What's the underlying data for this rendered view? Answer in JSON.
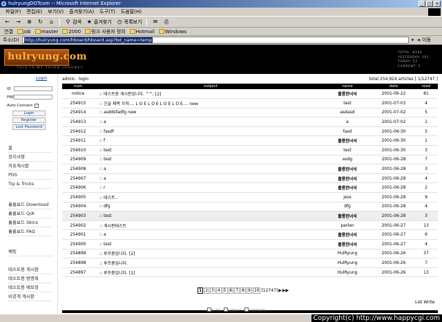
{
  "window": {
    "title": "hulryungDOTcom -- Microsoft Internet Explorer",
    "controls": [
      "_",
      "□",
      "×"
    ]
  },
  "menu": [
    "파일(F)",
    "편집(E)",
    "보기(V)",
    "즐겨찾기(A)",
    "도구(T)",
    "도움말(H)"
  ],
  "toolbar": {
    "back": "←",
    "forward": "→",
    "stop": "⊗",
    "refresh": "↻",
    "home": "⌂",
    "search": "검색",
    "favorites": "즐겨찾기",
    "history": "목록보기",
    "mail": "✉",
    "print": "⎙"
  },
  "links": {
    "label": "연결",
    "items": [
      "job",
      "master",
      "2000",
      "링크 사용자 정의",
      "Hotmail",
      "Windows"
    ]
  },
  "address": {
    "label": "주소(D)",
    "url": "http://hulryung.com/hboard/hboard.asp?bd_name=temp",
    "go": "이동"
  },
  "banner": {
    "logo": "hulryung.com",
    "tagline": "THIS IS MY THIRD JOURNEY",
    "stats": [
      "TOTAL: 8334",
      "YESTERDAY: 161",
      "TODAY: 53",
      "CURRENT: 5"
    ]
  },
  "sidebar": {
    "login_title": "Login",
    "id_label": "ID",
    "pwd_label": "PWD",
    "auto_connect": "Auto Connect",
    "login_button": "Login",
    "register_button": "Register",
    "lost_password": "Lost Password",
    "nav1": [
      "홈",
      "공지사항",
      "자유게시판",
      "PDS",
      "Tip & Tricks"
    ],
    "nav2": [
      "흘룡보드 Download",
      "흘룡보드 Q/A",
      "흘룡보드 Skinz",
      "흘룡보드 FAQ"
    ],
    "nav3": [
      "채팅"
    ],
    "nav4": [
      "테스트용 게시판",
      "테스트용 방명록",
      "테스트용 메모장",
      "비공개 게시판"
    ]
  },
  "board": {
    "admin": "admin",
    "login": "login",
    "total": "total 254,924 articles [ 1/12747 ]",
    "columns": [
      "num",
      "subject",
      "name",
      "date",
      "read"
    ],
    "rows": [
      {
        "num": "notice",
        "subject": ":: 테스트용 게시판입니다. ^^; [2]",
        "name": "흘룡한녀석",
        "date": "2001-06-22",
        "read": "81",
        "bold": true
      },
      {
        "num": "254915",
        "subject": ":: 긴글 제목 쓰자.... L O E L O E L O E L O E.... new",
        "name": "test",
        "date": "2001-07-03",
        "read": "4"
      },
      {
        "num": "254914",
        "subject": ":: asddsfadfg new",
        "name": "asdasd",
        "date": "2001-07-02",
        "read": "5"
      },
      {
        "num": "254913",
        "subject": ":: a",
        "name": "a",
        "date": "2001-07-02",
        "read": "1"
      },
      {
        "num": "254912",
        "subject": ":: fasdf",
        "name": "fasd",
        "date": "2001-06-30",
        "read": "5"
      },
      {
        "num": "254911",
        "subject": ":: f",
        "name": "흘룡한녀석",
        "date": "2001-06-30",
        "read": "1",
        "bold": true
      },
      {
        "num": "254910",
        "subject": ":: test",
        "name": "test",
        "date": "2001-06-30",
        "read": "3"
      },
      {
        "num": "254909",
        "subject": ":: test",
        "name": "asdg",
        "date": "2001-06-28",
        "read": "7"
      },
      {
        "num": "254908",
        "subject": ":: a",
        "name": "흘룡한녀석",
        "date": "2001-06-28",
        "read": "3",
        "bold": true
      },
      {
        "num": "254907",
        "subject": ":: a",
        "name": "흘룡한녀석",
        "date": "2001-06-28",
        "read": "4",
        "bold": true
      },
      {
        "num": "254906",
        "subject": ":: r",
        "name": "흘룡한녀석",
        "date": "2001-06-28",
        "read": "2",
        "bold": true
      },
      {
        "num": "254905",
        "subject": ":: 테스트..",
        "name": "jess",
        "date": "2001-06-28",
        "read": "9"
      },
      {
        "num": "254904",
        "subject": ":: dfg",
        "name": "dfg",
        "date": "2001-06-28",
        "read": "4"
      },
      {
        "num": "254903",
        "subject": ":: test",
        "name": "흘룡한녀석",
        "date": "2001-06-28",
        "read": "3",
        "bold": true,
        "highlight": true
      },
      {
        "num": "254902",
        "subject": ":: 게시판테스트",
        "name": "parker",
        "date": "2001-06-27",
        "read": "13"
      },
      {
        "num": "254901",
        "subject": ":: a",
        "name": "흘룡한녀석",
        "date": "2001-06-27",
        "read": "6",
        "bold": true
      },
      {
        "num": "254900",
        "subject": ":: test",
        "name": "흘룡한녀석",
        "date": "2001-06-27",
        "read": "4",
        "bold": true
      },
      {
        "num": "254899",
        "subject": ":: 루프중입니다. [2]",
        "name": "HulRyung",
        "date": "2001-06-26",
        "read": "37"
      },
      {
        "num": "254898",
        "subject": ":: 루프중입니다.",
        "name": "HulRyung",
        "date": "2001-06-26",
        "read": "7"
      },
      {
        "num": "254897",
        "subject": ":: 루프중입니다. [1]",
        "name": "HulRyung",
        "date": "2001-06-26",
        "read": "13"
      }
    ]
  },
  "pager": {
    "pages": [
      "1",
      "2",
      "3",
      "4",
      "5",
      "6",
      "7",
      "8",
      "9",
      "10"
    ],
    "last": "[12747]",
    "next": "▶",
    "next_block": "▶▶"
  },
  "footer": {
    "list": "List",
    "write": "Write",
    "search_options": [
      "NAME",
      "SUBJECT",
      "CONTENTS"
    ]
  },
  "copyright": "Copyright(c) http://www.happycgi.com"
}
